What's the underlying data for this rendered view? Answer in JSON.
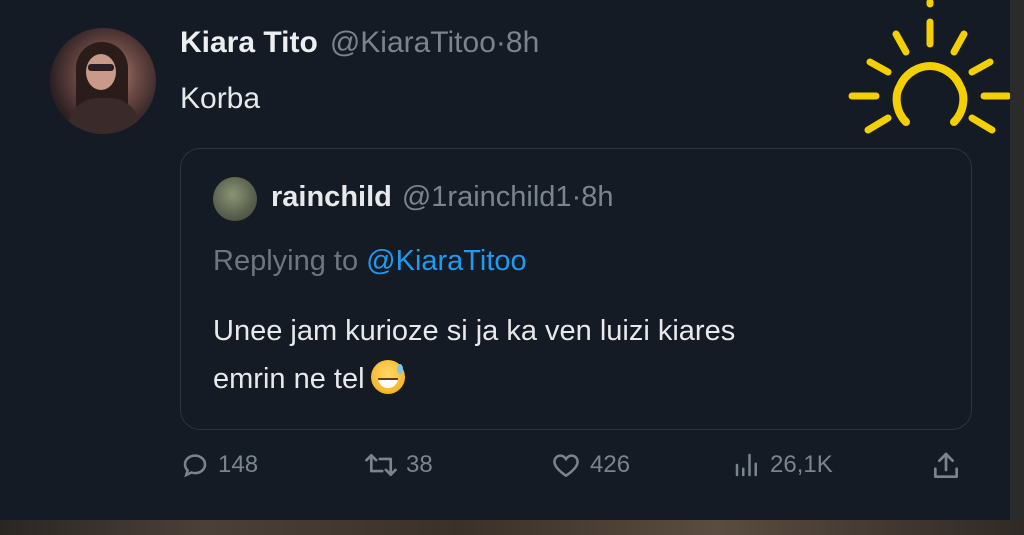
{
  "tweet": {
    "display_name": "Kiara Tito",
    "handle": "@KiaraTitoo",
    "separator": "·",
    "time": "8h",
    "text": "Korba"
  },
  "quoted_tweet": {
    "display_name": "rainchild",
    "handle": "@1rainchild1",
    "separator": "·",
    "time": "8h",
    "replying_prefix": "Replying to ",
    "replying_mention": "@KiaraTitoo",
    "text_line1": "Unee jam kurioze si ja ka ven luizi kiares",
    "text_line2": "emrin ne tel"
  },
  "actions": {
    "replies": "148",
    "retweets": "38",
    "likes": "426",
    "views": "26,1K"
  },
  "colors": {
    "background": "#151b24",
    "text_primary": "#e7e9ea",
    "text_secondary": "#7b848d",
    "link": "#1d9bf0",
    "sun": "#f4d000"
  },
  "icons": {
    "reply": "reply-icon",
    "retweet": "retweet-icon",
    "like": "heart-icon",
    "views": "views-chart-icon",
    "share": "share-icon",
    "overlay": "sun-icon",
    "emoji": "grinning-sweat-emoji"
  }
}
